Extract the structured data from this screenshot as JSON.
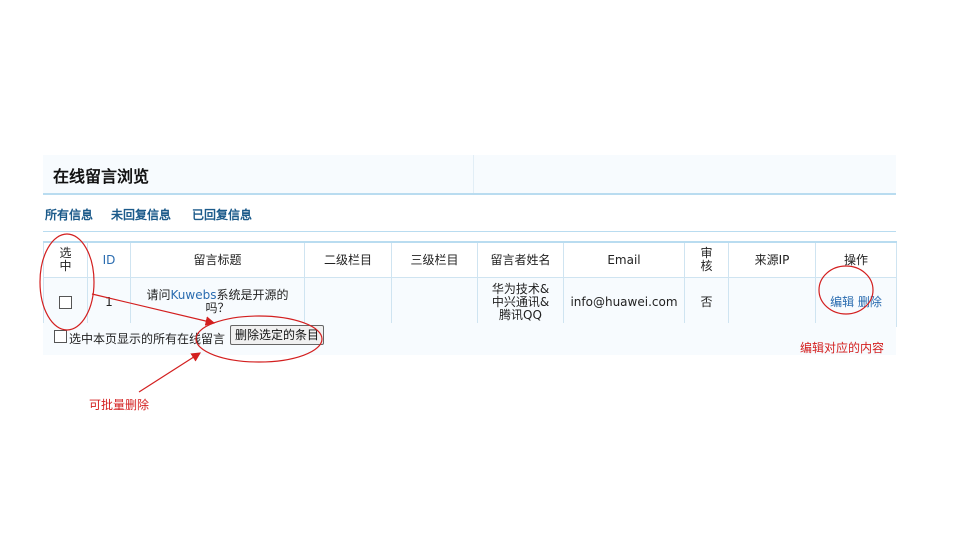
{
  "header": {
    "title": "在线留言浏览"
  },
  "filters": [
    "所有信息",
    "未回复信息",
    "已回复信息"
  ],
  "table": {
    "columns": [
      "选中",
      "ID",
      "留言标题",
      "二级栏目",
      "三级栏目",
      "留言者姓名",
      "Email",
      "审核",
      "来源IP",
      "操作"
    ],
    "rows": [
      {
        "id": "1",
        "title_prefix": "请问",
        "title_link": "Kuwebs",
        "title_suffix": "系统是开源的吗？",
        "level2": "",
        "level3": "",
        "author": "华为技术&中兴通讯&腾讯QQ",
        "email": "info@huawei.com",
        "approved": "否",
        "ip": "",
        "actions": {
          "edit": "编辑",
          "delete": "删除"
        }
      }
    ]
  },
  "bulk": {
    "select_all_label": "选中本页显示的所有在线留言",
    "delete_button": "删除选定的条目"
  },
  "annotations": {
    "batch_delete": "可批量删除",
    "edit_content": "编辑对应的内容"
  },
  "colors": {
    "accent": "#2a6cb0",
    "annotation": "#d31f1f",
    "border": "#b9dcf0"
  }
}
